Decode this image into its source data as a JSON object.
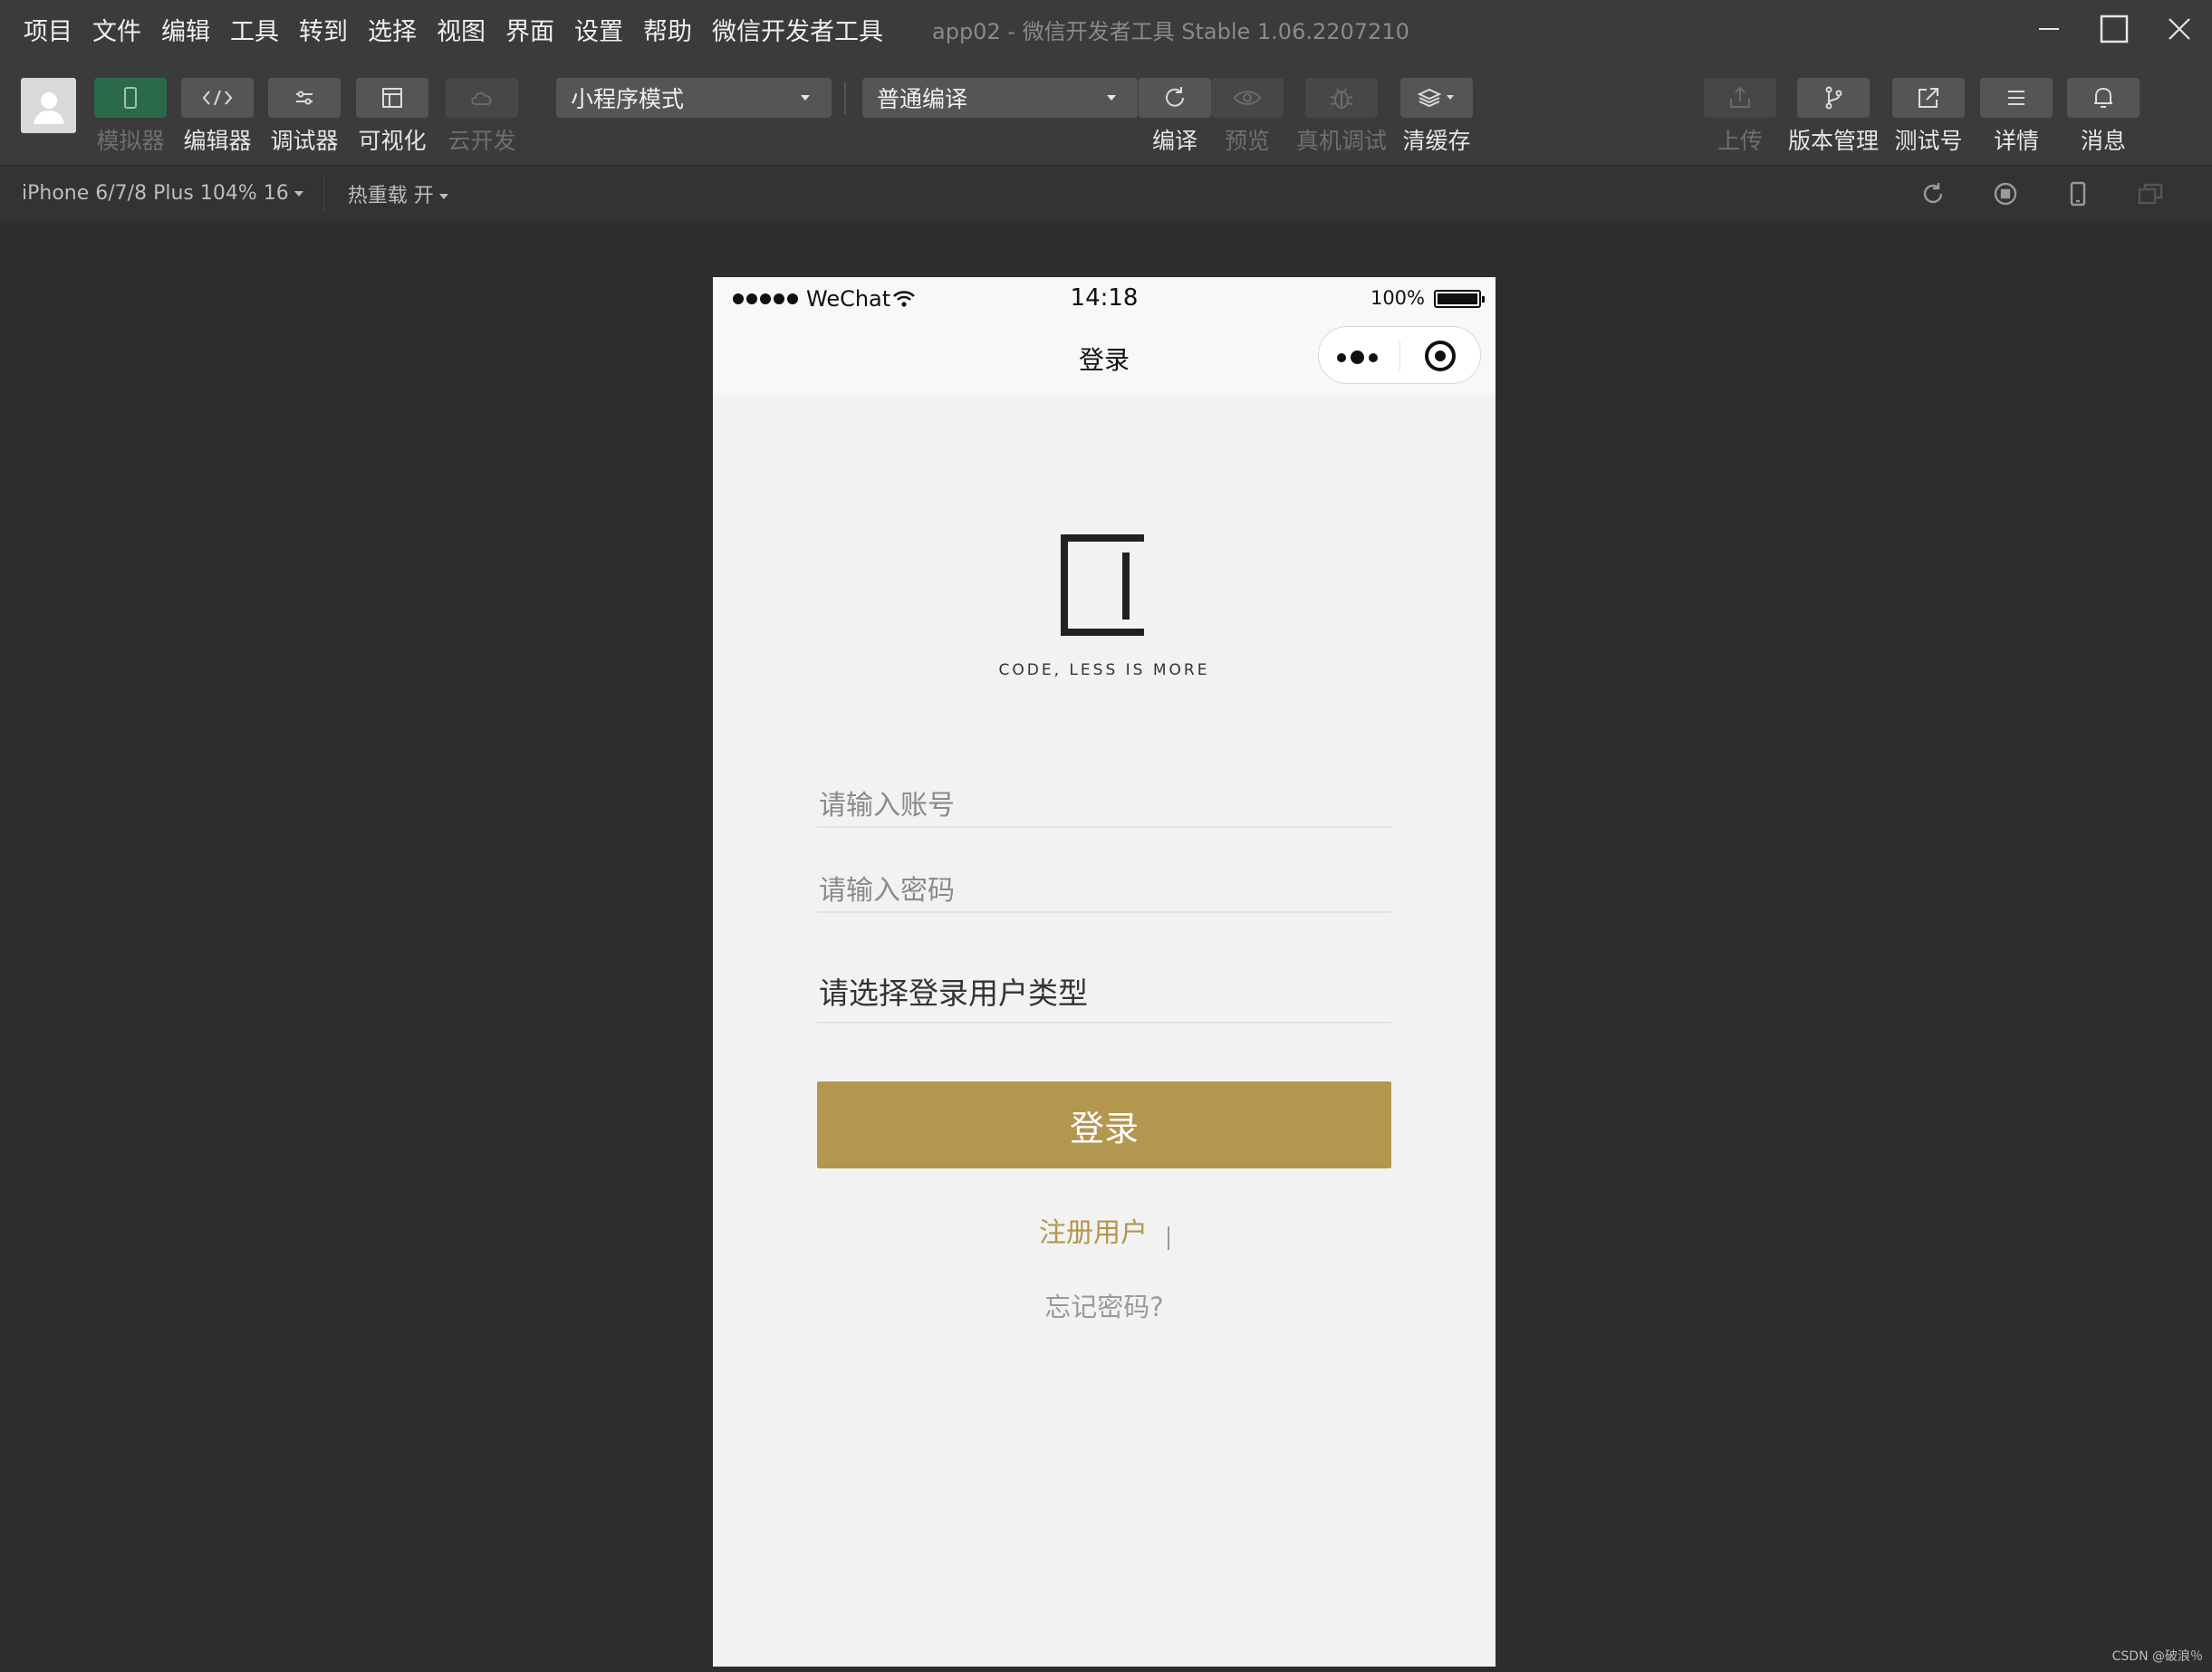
{
  "menubar": {
    "items": [
      "项目",
      "文件",
      "编辑",
      "工具",
      "转到",
      "选择",
      "视图",
      "界面",
      "设置",
      "帮助",
      "微信开发者工具"
    ],
    "title": "app02 - 微信开发者工具 Stable 1.06.2207210"
  },
  "toolbar": {
    "simulator": "模拟器",
    "editor": "编辑器",
    "debugger": "调试器",
    "visual": "可视化",
    "cloud": "云开发",
    "mode_select": "小程序模式",
    "compile_select": "普通编译",
    "compile": "编译",
    "preview": "预览",
    "remote_debug": "真机调试",
    "clear_cache": "清缓存",
    "upload": "上传",
    "version": "版本管理",
    "test_account": "测试号",
    "details": "详情",
    "messages": "消息"
  },
  "subbar": {
    "device": "iPhone 6/7/8 Plus 104% 16",
    "hot_reload": "热重载 开"
  },
  "phone": {
    "carrier": "WeChat",
    "time": "14:18",
    "battery": "100%",
    "nav_title": "登录",
    "slogan": "CODE, LESS IS MORE",
    "account_placeholder": "请输入账号",
    "password_placeholder": "请输入密码",
    "user_type": "请选择登录用户类型",
    "login_button": "登录",
    "register": "注册用户",
    "forgot": "忘记密码?"
  },
  "watermark": "CSDN @破浪％",
  "colors": {
    "accent": "#b3974f",
    "ide_background": "#2d2d2d",
    "toolbar": "#3b3b3b",
    "active_tool": "#2a6a49"
  }
}
